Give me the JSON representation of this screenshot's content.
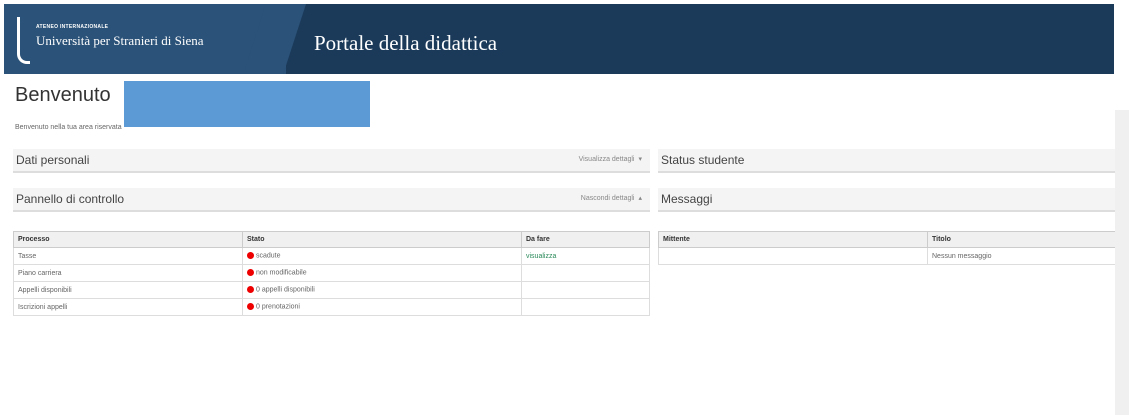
{
  "header": {
    "institution_small": "ATENEO INTERNAZIONALE",
    "institution_name": "Università per Stranieri di Siena",
    "portal_title": "Portale della didattica"
  },
  "welcome": {
    "title": "Benvenuto",
    "subtitle": "Benvenuto nella tua area riservata"
  },
  "panels": {
    "personal": {
      "title": "Dati personali",
      "link": "Visualizza dettagli"
    },
    "control": {
      "title": "Pannello di controllo",
      "link": "Nascondi dettagli"
    },
    "status": {
      "title": "Status studente"
    },
    "messages": {
      "title": "Messaggi"
    }
  },
  "process_table": {
    "headers": [
      "Processo",
      "Stato",
      "Da fare"
    ],
    "rows": [
      {
        "process": "Tasse",
        "status": "scadute",
        "action": "visualizza",
        "status_color": "#e00000"
      },
      {
        "process": "Piano carriera",
        "status": "non modificabile",
        "action": "",
        "status_color": "#e00000"
      },
      {
        "process": "Appelli disponibili",
        "status": "0 appelli disponibili",
        "action": "",
        "status_color": "#e00000"
      },
      {
        "process": "Iscrizioni appelli",
        "status": "0 prenotazioni",
        "action": "",
        "status_color": "#e00000"
      }
    ]
  },
  "messages_table": {
    "headers": [
      "Mittente",
      "Titolo"
    ],
    "empty_text": "Nessun messaggio"
  },
  "colors": {
    "header_bg": "#1b3a5a",
    "header_logo_bg": "#2b5278",
    "status_red": "#e00000",
    "link_green": "#2a8a5a"
  }
}
